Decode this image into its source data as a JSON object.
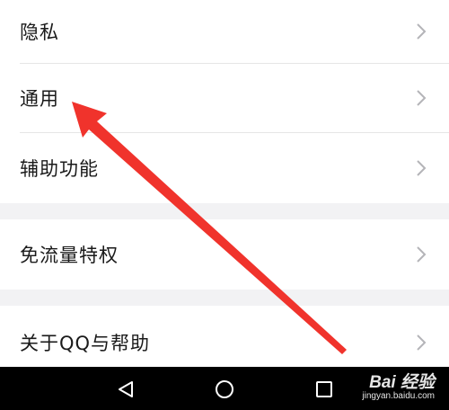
{
  "settings": {
    "items": [
      {
        "label": "隐私"
      },
      {
        "label": "通用"
      },
      {
        "label": "辅助功能"
      },
      {
        "label": "免流量特权"
      },
      {
        "label": "关于QQ与帮助"
      }
    ]
  },
  "nav": {
    "back_icon": "triangle-back-icon",
    "home_icon": "circle-home-icon",
    "recents_icon": "square-recents-icon"
  },
  "watermark": {
    "logo": "Bai 经验",
    "url": "jingyan.baidu.com"
  },
  "colors": {
    "arrow": "#f0332c",
    "chevron": "#b4b4b8",
    "separator_band": "#f2f2f4",
    "nav_bar": "#000000"
  }
}
